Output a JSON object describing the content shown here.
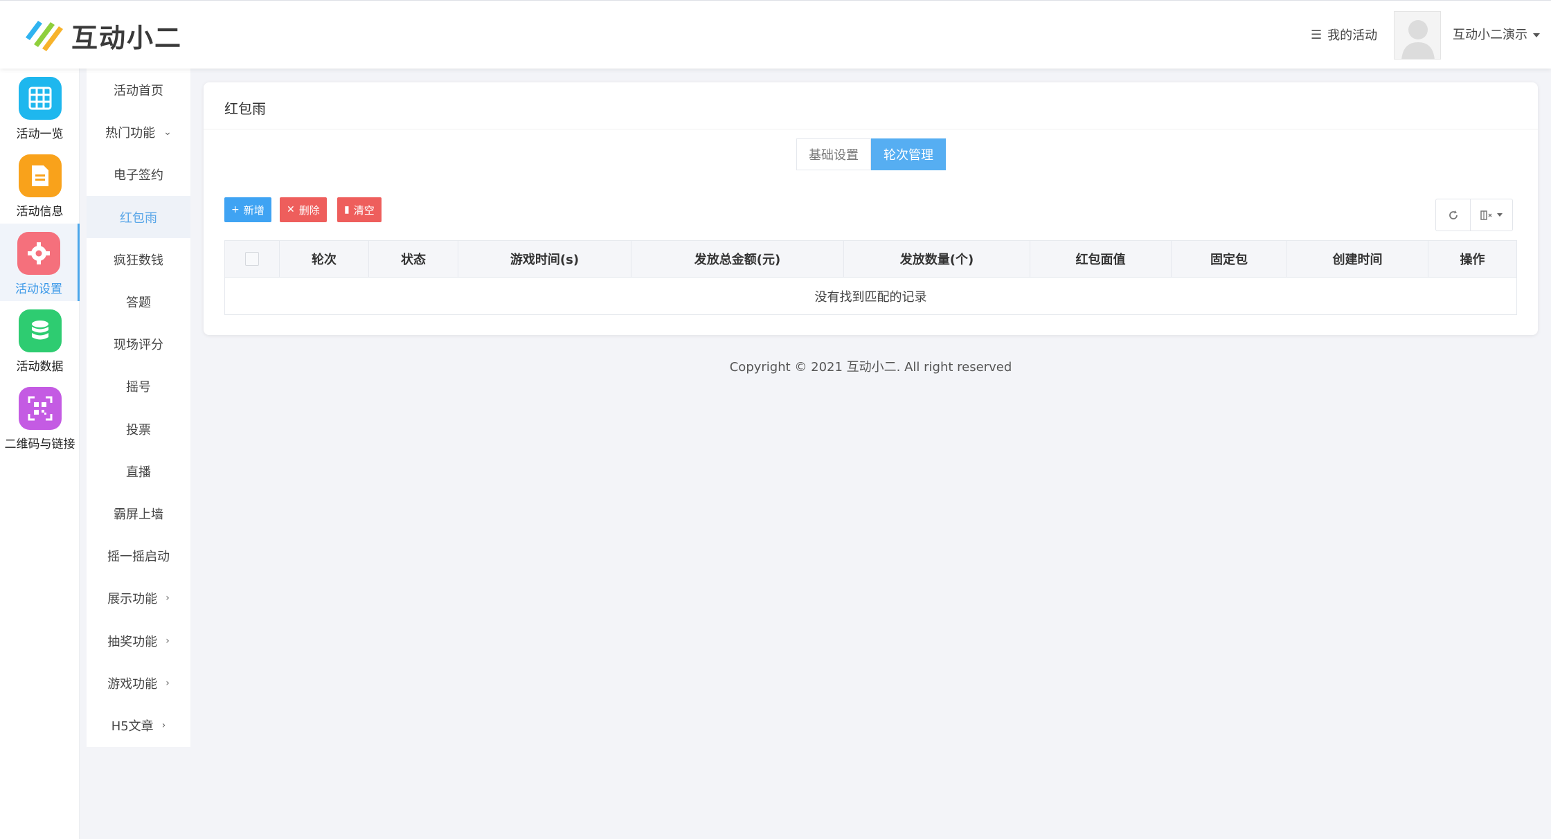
{
  "header": {
    "logo_text": "互动小二",
    "my_activity": "我的活动",
    "user_name": "互动小二演示"
  },
  "iconbar": {
    "items": [
      {
        "label": "活动一览",
        "icon": "grid-icon",
        "color": "#1eb7ee"
      },
      {
        "label": "活动信息",
        "icon": "document-icon",
        "color": "#f9a21b"
      },
      {
        "label": "活动设置",
        "icon": "gear-icon",
        "color": "#f5707c",
        "active": true
      },
      {
        "label": "活动数据",
        "icon": "database-icon",
        "color": "#2ecc71"
      },
      {
        "label": "二维码与链接",
        "icon": "qrcode-icon",
        "color": "#c45be3"
      }
    ]
  },
  "submenu": {
    "items": [
      {
        "label": "活动首页"
      },
      {
        "label": "热门功能",
        "arrow": "⌄"
      },
      {
        "label": "电子签约"
      },
      {
        "label": "红包雨",
        "active": true
      },
      {
        "label": "疯狂数钱"
      },
      {
        "label": "答题"
      },
      {
        "label": "现场评分"
      },
      {
        "label": "摇号"
      },
      {
        "label": "投票"
      },
      {
        "label": "直播"
      },
      {
        "label": "霸屏上墙"
      },
      {
        "label": "摇一摇启动"
      },
      {
        "label": "展示功能",
        "arrow": "›"
      },
      {
        "label": "抽奖功能",
        "arrow": "›"
      },
      {
        "label": "游戏功能",
        "arrow": "›"
      },
      {
        "label": "H5文章",
        "arrow": "›"
      }
    ]
  },
  "main": {
    "title": "红包雨",
    "tabs": [
      {
        "label": "基础设置"
      },
      {
        "label": "轮次管理",
        "active": true
      }
    ],
    "toolbar": {
      "add_icon": "+",
      "add_label": "新增",
      "delete_icon": "✕",
      "delete_label": "删除",
      "clear_icon": "▮",
      "clear_label": "清空"
    },
    "table": {
      "columns": [
        "轮次",
        "状态",
        "游戏时间(s)",
        "发放总金额(元)",
        "发放数量(个)",
        "红包面值",
        "固定包",
        "创建时间",
        "操作"
      ],
      "empty_text": "没有找到匹配的记录"
    }
  },
  "footer": {
    "copyright": "Copyright © 2021 互动小二. All right reserved"
  }
}
